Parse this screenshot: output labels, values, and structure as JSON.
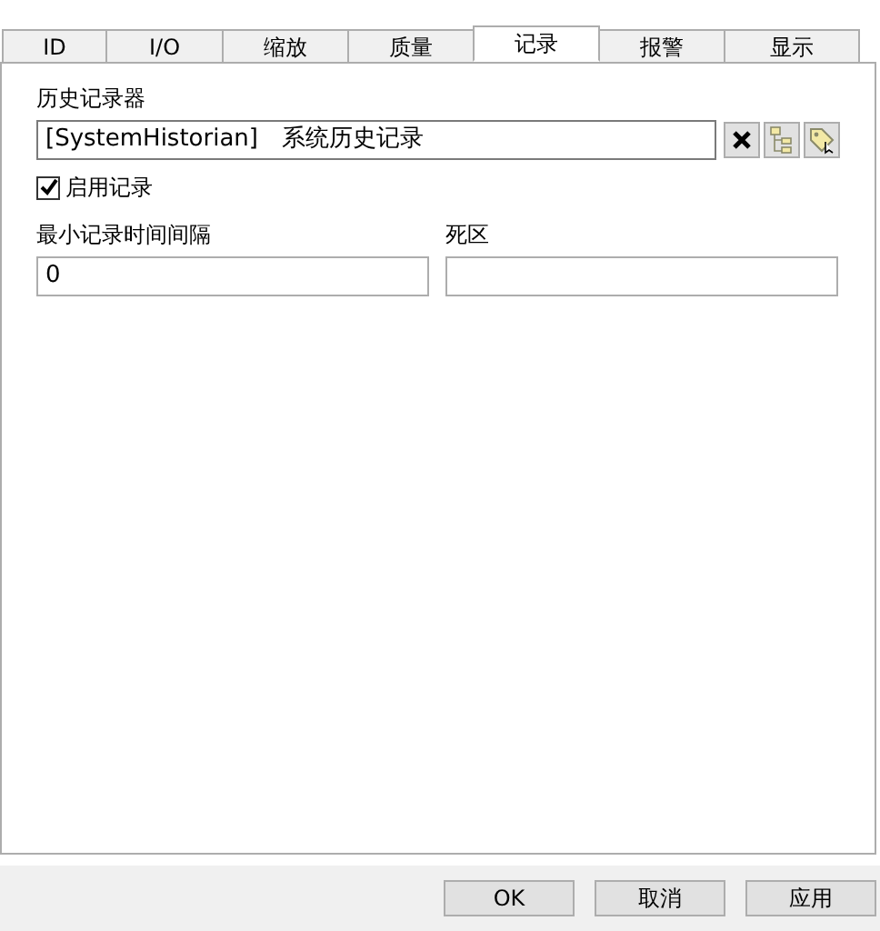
{
  "tabs": [
    {
      "label": "ID",
      "selected": false
    },
    {
      "label": "I/O",
      "selected": false
    },
    {
      "label": "缩放",
      "selected": false
    },
    {
      "label": "质量",
      "selected": false
    },
    {
      "label": "记录",
      "selected": true
    },
    {
      "label": "报警",
      "selected": false
    },
    {
      "label": "显示",
      "selected": false
    }
  ],
  "historian": {
    "label": "历史记录器",
    "value": "[SystemHistorian]　系统历史记录"
  },
  "enable_logging": {
    "label": "启用记录",
    "checked": true
  },
  "fields": [
    {
      "label": "最小记录时间间隔",
      "value": "0"
    },
    {
      "label": "死区"
    }
  ],
  "buttons": [
    "OK",
    "取消",
    "应用"
  ]
}
